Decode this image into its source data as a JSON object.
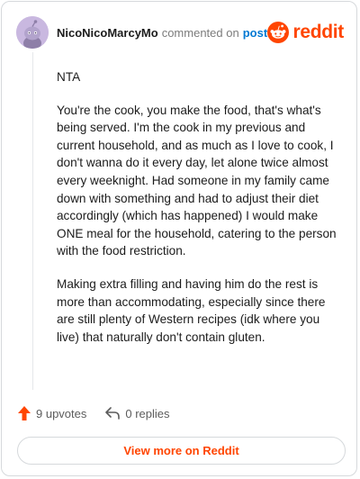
{
  "header": {
    "username": "NicoNicoMarcyMo",
    "action_text": "commented on",
    "post_link": "post",
    "logo_text": "reddit"
  },
  "comment": {
    "paragraphs": [
      "NTA",
      "You're the cook, you make the food, that's what's being served. I'm the cook in my previous and current household, and as much as I love to cook, I don't wanna do it every day, let alone twice almost every weeknight. Had someone in my family came down with something and had to adjust their diet accordingly (which has happened) I would make ONE meal for the household, catering to the person with the food restriction.",
      "Making extra filling and having him do the rest is more than accommodating, especially since there are still plenty of Western recipes (idk where you live) that naturally don't contain gluten."
    ]
  },
  "footer": {
    "upvotes_label": "9 upvotes",
    "replies_label": "0 replies"
  },
  "view_more_label": "View more on Reddit",
  "colors": {
    "brand": "#ff4500",
    "link": "#0079d3",
    "avatar_bg": "#c9b8e0"
  },
  "icons": [
    "snoo-avatar-icon",
    "reddit-logo-icon",
    "upvote-arrow-icon",
    "reply-arrow-icon"
  ]
}
